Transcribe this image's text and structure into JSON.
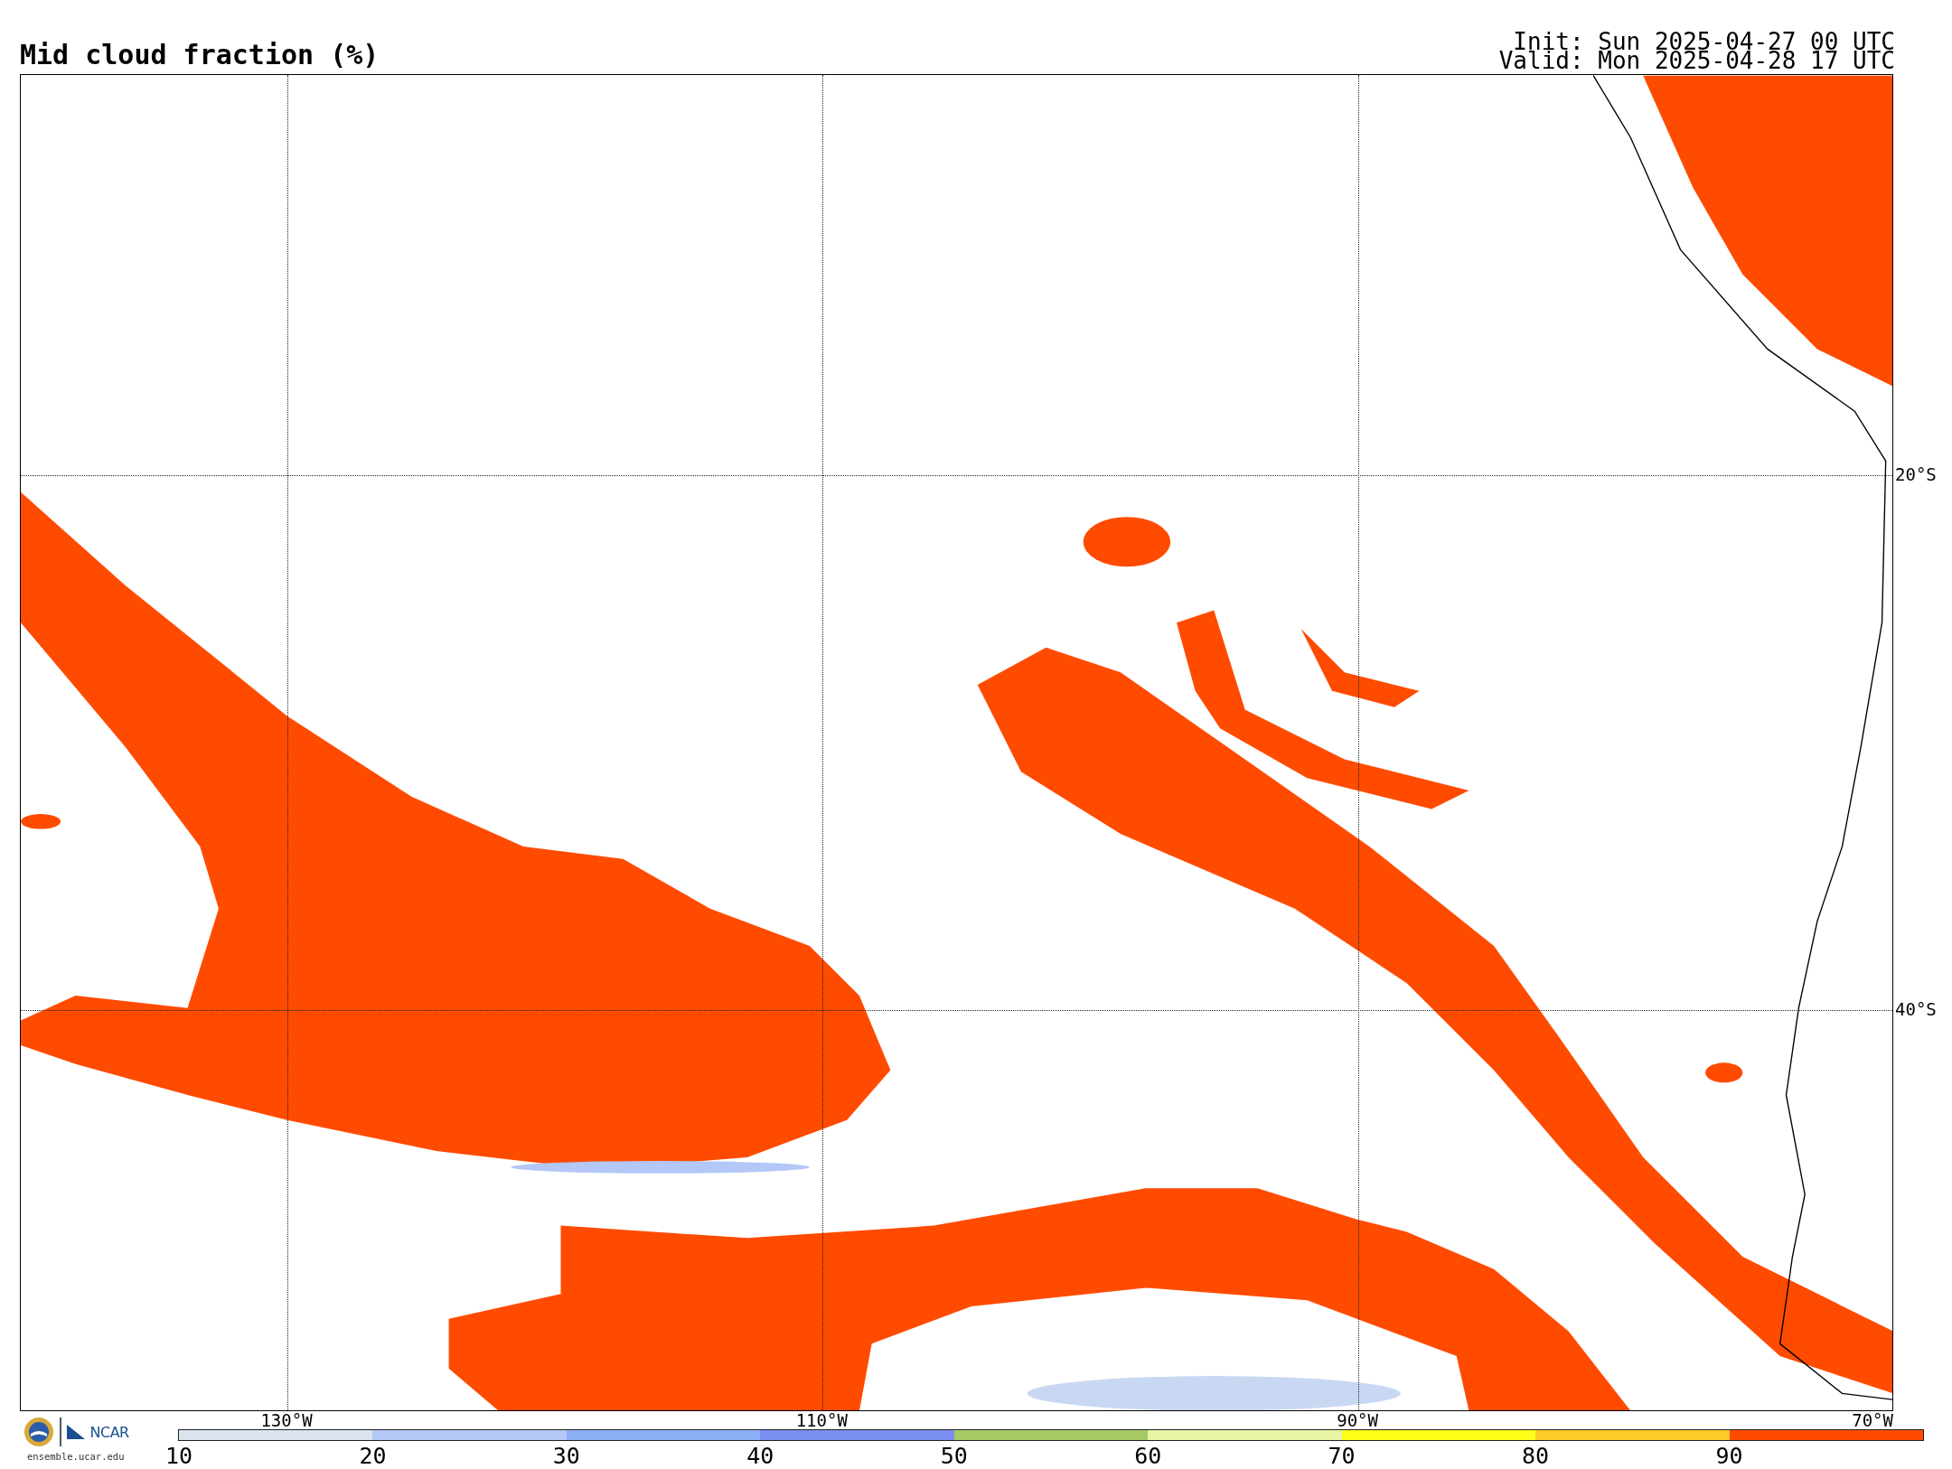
{
  "title": "Mid cloud fraction (%)",
  "init": "Init: Sun 2025-04-27 00 UTC",
  "valid": "Valid: Mon 2025-04-28 17 UTC",
  "map": {
    "lon_labels": [
      "130°W",
      "110°W",
      "90°W",
      "70°W"
    ],
    "lat_labels": [
      "20°S",
      "40°S"
    ]
  },
  "colorbar": {
    "bins": [
      {
        "label": "10",
        "color": "#dbe4ee"
      },
      {
        "label": "20",
        "color": "#b3c8f7"
      },
      {
        "label": "30",
        "color": "#8caff6"
      },
      {
        "label": "40",
        "color": "#7a8ef2"
      },
      {
        "label": "50",
        "color": "#a6c965"
      },
      {
        "label": "60",
        "color": "#e7f4a6"
      },
      {
        "label": "70",
        "color": "#ffff19"
      },
      {
        "label": "80",
        "color": "#fdcb29"
      },
      {
        "label": "90",
        "color": "#ff4b00"
      }
    ]
  },
  "logo": {
    "name": "NCAR",
    "site": "ensemble.ucar.edu"
  }
}
